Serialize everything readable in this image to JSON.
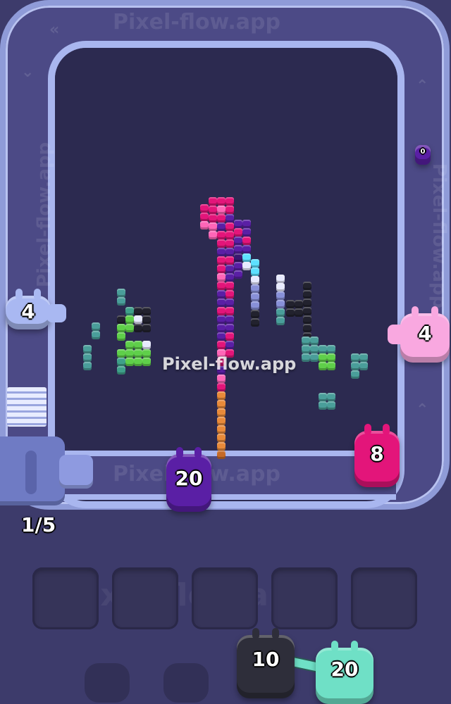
{
  "watermark": {
    "text": "Pixel-flow.app"
  },
  "queue": {
    "counter": "1/5"
  },
  "shooters": {
    "left_value": "4",
    "right_value": "4",
    "bottom_purple_value": "20",
    "bottom_pink_value": "8",
    "waiting_black_value": "10",
    "waiting_teal_value": "20",
    "tiny_top_right_value": "0"
  },
  "colors": {
    "background": "#3d3b6b",
    "track": "#4c4a86",
    "board": "#2c2a50",
    "pig_periwinkle": "#a9b8f2",
    "pig_pink": "#f9a8e0",
    "pig_purple": "#5a1fa5",
    "pig_magenta": "#e3157a",
    "pig_black": "#2e2e3a",
    "pig_teal": "#6fe0c6"
  },
  "slots": {
    "count": 5
  }
}
